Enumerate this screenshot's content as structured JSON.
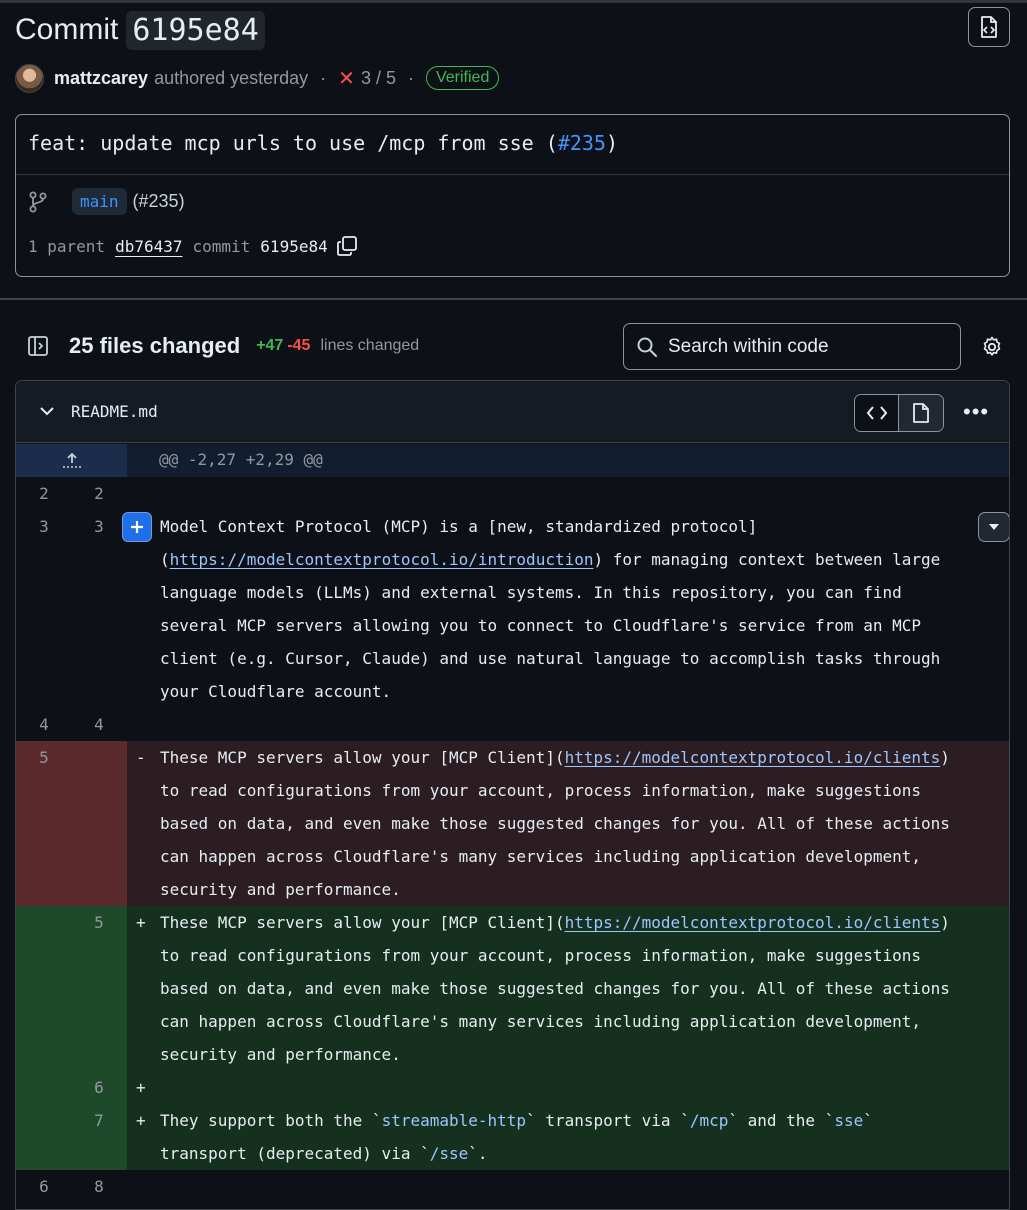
{
  "header": {
    "title_word": "Commit",
    "sha": "6195e84",
    "author": "mattzcarey",
    "authored": "authored yesterday",
    "separator": "·",
    "checks": "3 / 5",
    "verified": "Verified"
  },
  "commit": {
    "message_prefix": "feat: update mcp urls to use /mcp from sse (",
    "message_pr": "#235",
    "message_suffix": ")",
    "branch": "main",
    "branch_pr": "(#235)",
    "parent_label": "1 parent",
    "parent_sha": "db76437",
    "commit_label": "commit",
    "commit_sha": "6195e84"
  },
  "diffbar": {
    "files_changed": "25 files changed",
    "additions": "+47",
    "deletions": "-45",
    "lines_changed": "lines changed",
    "search_placeholder": "Search within code"
  },
  "file": {
    "name": "README.md",
    "hunk": "@@ -2,27 +2,29 @@"
  },
  "lines": {
    "l1": {
      "old": "2",
      "new": "2"
    },
    "l2": {
      "old": "3",
      "new": "3",
      "t1": "Model Context Protocol (MCP) is a [new, standardized protocol]",
      "t2a": "(",
      "t2link": "https://modelcontextprotocol.io/introduction",
      "t2b": ") for managing context between large",
      "t3": "language models (LLMs) and external systems. In this repository, you can find",
      "t4": "several MCP servers allowing you to connect to Cloudflare's service from an MCP",
      "t5": "client (e.g. Cursor, Claude) and use natural language to accomplish tasks through",
      "t6": "your Cloudflare account."
    },
    "l3": {
      "old": "4",
      "new": "4"
    },
    "del": {
      "old": "5",
      "sign": "-",
      "t1a": "These MCP servers allow your [MCP Client](",
      "t1link": "https://modelcontextprotocol.io/clients",
      "t1b": ")",
      "t2": "to read configurations from your account, process information, make suggestions",
      "t3": "based on data, and even make those suggested changes for you. All of these actions",
      "t4": "can happen across Cloudflare's many services including application development,",
      "t5": "security and performance."
    },
    "add1": {
      "new": "5",
      "sign": "+",
      "t1a": "These MCP servers allow your [MCP Client](",
      "t1link": "https://modelcontextprotocol.io/clients",
      "t1b": ")",
      "t2": "to read configurations from your account, process information, make suggestions",
      "t3": "based on data, and even make those suggested changes for you. All of these actions",
      "t4": "can happen across Cloudflare's many services including application development,",
      "t5": "security and performance."
    },
    "add2": {
      "new": "6",
      "sign": "+"
    },
    "add3": {
      "new": "7",
      "sign": "+",
      "a": "They support both the `",
      "b": "streamable-http",
      "c": "` transport via `",
      "d": "/mcp",
      "e": "` and the `",
      "f": "sse",
      "g": "`",
      "h": "transport (deprecated) via `",
      "i": "/sse",
      "j": "`."
    },
    "l4": {
      "old": "6",
      "new": "8"
    }
  },
  "colors": {
    "background": "#0d1117",
    "link": "#4493f8",
    "added": "#3fb950",
    "deleted": "#f85149"
  }
}
